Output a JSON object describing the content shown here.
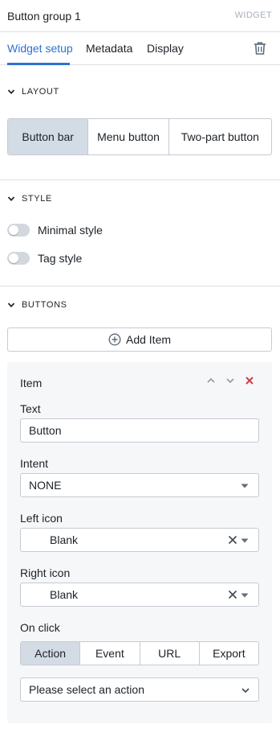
{
  "header": {
    "title": "Button group 1",
    "kind": "WIDGET"
  },
  "tabs": [
    {
      "label": "Widget setup",
      "active": true
    },
    {
      "label": "Metadata",
      "active": false
    },
    {
      "label": "Display",
      "active": false
    }
  ],
  "layout": {
    "heading": "LAYOUT",
    "options": [
      "Button bar",
      "Menu button",
      "Two-part button"
    ],
    "selected": "Button bar"
  },
  "style": {
    "heading": "STYLE",
    "toggles": [
      {
        "label": "Minimal style",
        "on": false
      },
      {
        "label": "Tag style",
        "on": false
      }
    ]
  },
  "buttons": {
    "heading": "BUTTONS",
    "add_label": "Add Item",
    "item": {
      "title": "Item",
      "text_label": "Text",
      "text_value": "Button",
      "intent_label": "Intent",
      "intent_value": "NONE",
      "left_icon_label": "Left icon",
      "left_icon_value": "Blank",
      "right_icon_label": "Right icon",
      "right_icon_value": "Blank",
      "on_click_label": "On click",
      "on_click_options": [
        "Action",
        "Event",
        "URL",
        "Export"
      ],
      "on_click_selected": "Action",
      "action_placeholder": "Please select an action"
    }
  },
  "colors": {
    "accent": "#2d72d2",
    "delete": "#cd4246",
    "segment_active": "#d3dbe5",
    "card_bg": "#f6f7f9"
  }
}
